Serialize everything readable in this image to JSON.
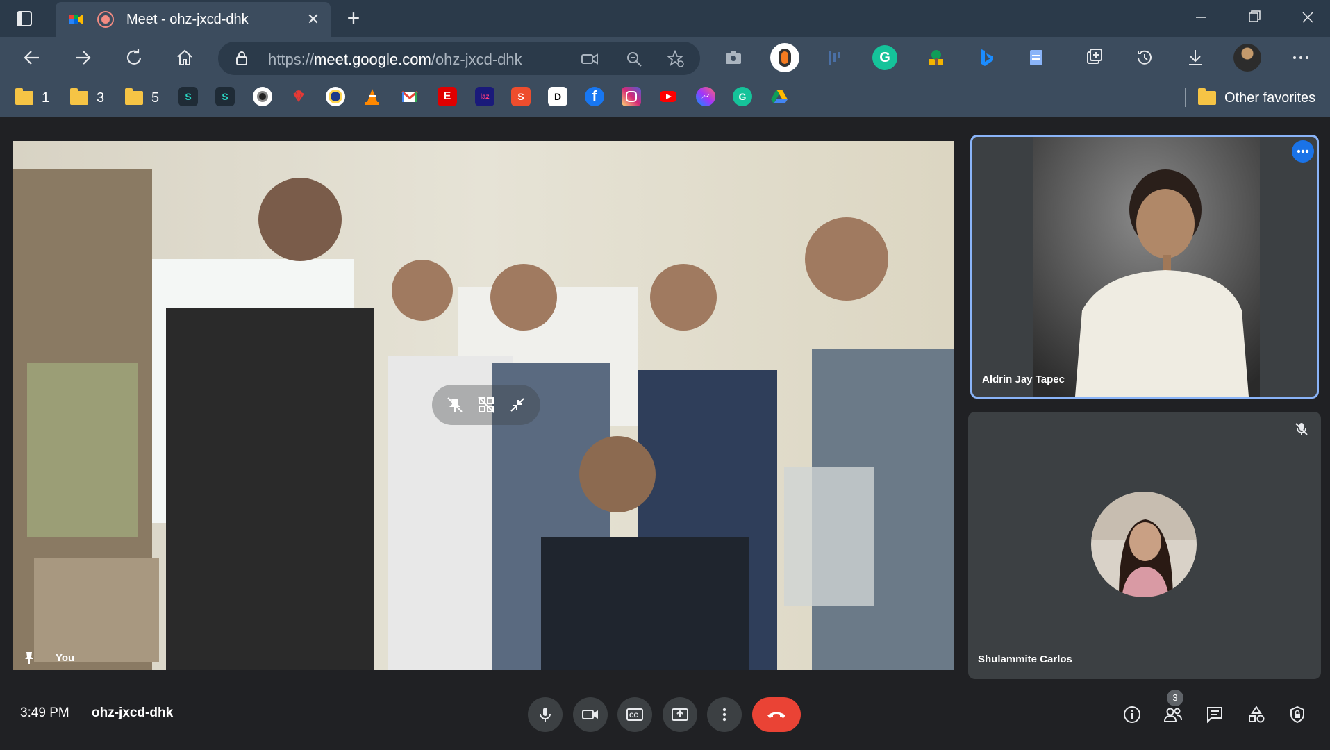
{
  "browser": {
    "tab_title": "Meet - ohz-jxcd-dhk",
    "tab_close": "✕",
    "new_tab": "+",
    "url_scheme": "https://",
    "url_host": "meet.google.com",
    "url_path": "/ohz-jxcd-dhk"
  },
  "bookmarks": {
    "folders": [
      {
        "label": "1"
      },
      {
        "label": "3"
      },
      {
        "label": "5"
      }
    ],
    "other_favorites": "Other favorites"
  },
  "meeting": {
    "main_tile_name": "You",
    "participants": [
      {
        "name": "Aldrin Jay Tapec"
      },
      {
        "name": "Shulammite Carlos"
      }
    ],
    "time": "3:49 PM",
    "code": "ohz-jxcd-dhk",
    "people_count": "3"
  },
  "colors": {
    "accent": "#8ab4f8",
    "end_call": "#ea4335",
    "more_button": "#1a73e8"
  }
}
